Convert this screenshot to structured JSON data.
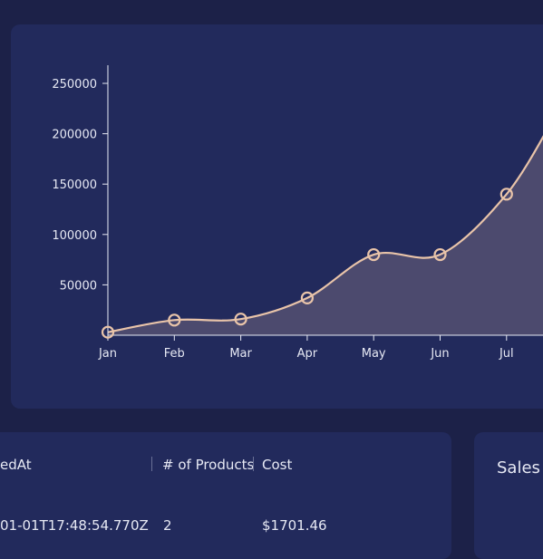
{
  "chart_data": {
    "type": "area",
    "categories": [
      "Jan",
      "Feb",
      "Mar",
      "Apr",
      "May",
      "Jun",
      "Jul"
    ],
    "series": [
      {
        "values": [
          3000,
          15000,
          16000,
          37000,
          80000,
          80000,
          140000
        ]
      }
    ],
    "yticks": [
      50000,
      100000,
      150000,
      200000,
      250000
    ],
    "ytick_labels": [
      "50000",
      "100000",
      "150000",
      "200000",
      "250000"
    ],
    "ylim": [
      0,
      268000
    ],
    "colors": {
      "line": "#e9c4a9",
      "fill": "#4c4a6e",
      "axis": "#e7e9f4"
    }
  },
  "orders_table": {
    "headers": [
      "edAt",
      "# of Products",
      "Cost"
    ],
    "rows": [
      {
        "created_at": "01-01T17:48:54.770Z",
        "products": "2",
        "cost": "$1701.46"
      }
    ]
  },
  "sales_panel": {
    "title": "Sales"
  }
}
